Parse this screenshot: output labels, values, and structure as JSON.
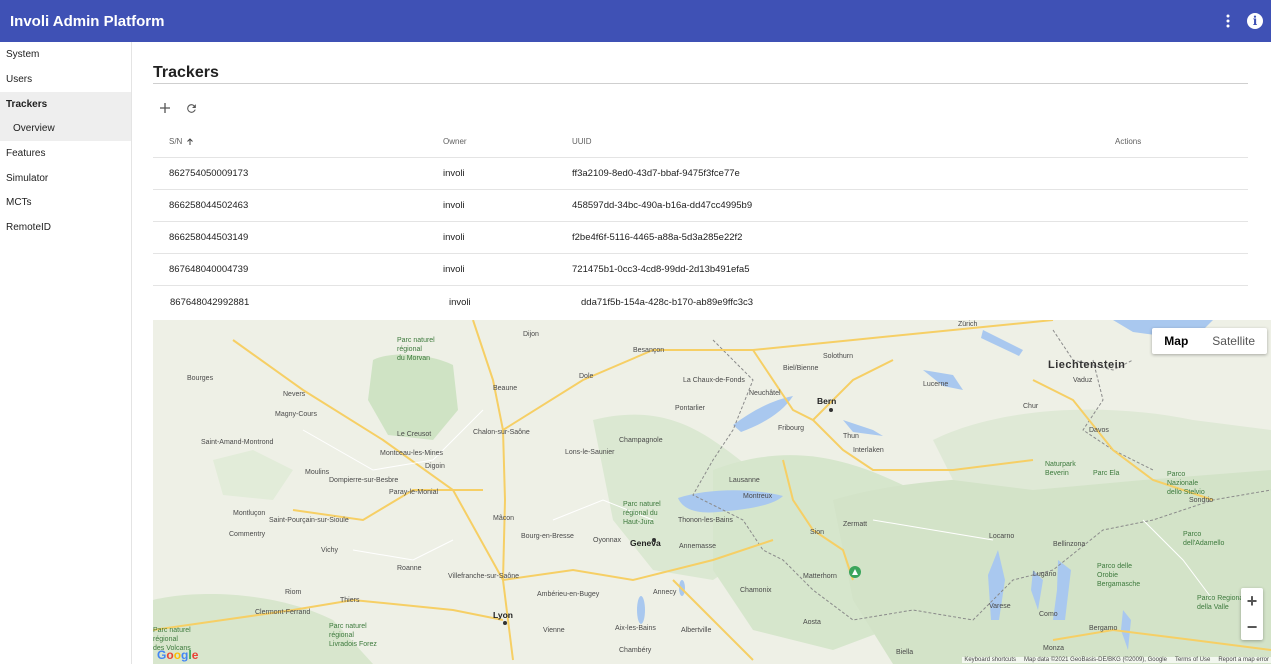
{
  "app": {
    "title": "Involi Admin Platform"
  },
  "sidebar": {
    "items": [
      {
        "label": "System"
      },
      {
        "label": "Users"
      },
      {
        "label": "Trackers"
      },
      {
        "label": "Overview"
      },
      {
        "label": "Features"
      },
      {
        "label": "Simulator"
      },
      {
        "label": "MCTs"
      },
      {
        "label": "RemoteID"
      }
    ],
    "active": "Trackers"
  },
  "page": {
    "title": "Trackers"
  },
  "toolbar": {
    "add_icon": "add-icon",
    "refresh_icon": "refresh-icon"
  },
  "table": {
    "headers": {
      "sn": "S/N",
      "owner": "Owner",
      "uuid": "UUID",
      "actions": "Actions"
    },
    "sort": {
      "column": "S/N",
      "direction": "ascending"
    },
    "rows": [
      {
        "sn": "862754050009173",
        "owner": "involi",
        "uuid": "ff3a2109-8ed0-43d7-bbaf-9475f3fce77e"
      },
      {
        "sn": "866258044502463",
        "owner": "involi",
        "uuid": "458597dd-34bc-490a-b16a-dd47cc4995b9"
      },
      {
        "sn": "866258044503149",
        "owner": "involi",
        "uuid": "f2be4f6f-5116-4465-a88a-5d3a285e22f2"
      },
      {
        "sn": "867648040004739",
        "owner": "involi",
        "uuid": "721475b1-0cc3-4cd8-99dd-2d13b491efa5"
      },
      {
        "sn": "867648042992881",
        "owner": "involi",
        "uuid": "dda71f5b-154a-428c-b170-ab89e9ffc3c3"
      }
    ]
  },
  "map": {
    "toggle": {
      "map": "Map",
      "satellite": "Satellite",
      "selected": "Map"
    },
    "zoom": {
      "in": "+",
      "out": "−"
    },
    "logo": "Google",
    "attribution": {
      "shortcuts": "Keyboard shortcuts",
      "data": "Map data ©2021 GeoBasis-DE/BKG (©2009), Google",
      "terms": "Terms of Use",
      "report": "Report a map error"
    },
    "labels": {
      "countries": [
        "Liechtenstein"
      ],
      "cities_major": [
        "Bern",
        "Geneva",
        "Lyon"
      ],
      "cities": [
        "Zürich",
        "Dijon",
        "Besançon",
        "Bourges",
        "Nevers",
        "Beaune",
        "Dole",
        "Solothurn",
        "Biel/Bienne",
        "Luzern",
        "Vaduz",
        "La Chaux-de-Fonds",
        "Neuchâtel",
        "Pontarlier",
        "Fribourg",
        "Thun",
        "Le Creusot",
        "Chalon-sur-Saône",
        "Champagnole",
        "Montceau-les-Mines",
        "Lons-le-Saunier",
        "Moulins",
        "Lausanne",
        "Montreux",
        "Montluçon",
        "Mâcon",
        "Thonon-les-Bains",
        "Sion",
        "Vichy",
        "Bourg-en-Bresse",
        "Oyonnax",
        "Annemasse",
        "Roanne",
        "Villefranche-sur-Saône",
        "Annecy",
        "Chamonix",
        "Clermont-Ferrand",
        "Thiers",
        "Chambéry",
        "Albertville",
        "Aosta",
        "Biella",
        "Varese",
        "Como",
        "Bergamo",
        "Monza",
        "Lugano",
        "Davos",
        "Chur",
        "Interlaken",
        "Matterhorn",
        "Zermatt",
        "Vienne",
        "Aix-les-Bains",
        "Riom",
        "Digoin",
        "Paray-le-Monial",
        "Commentry",
        "Saint-Pourçain-sur-Sioule",
        "Saint-Amand-Montrond",
        "Magny-Cours",
        "Dompierre-sur-Besbre",
        "Ambérieu-en-Bugey",
        "Sondrio",
        "Bellinzona",
        "Locarno"
      ],
      "parks": [
        "Parc naturel régional du Morvan",
        "Parc naturel régional du Haut-Jura",
        "Parc naturel régional Livradois Forez",
        "Parc naturel régional des Volcans",
        "Naturpark Beverin",
        "Parc Ela",
        "Parco Nazionale dello Stelvio",
        "Parco dell'Adamello",
        "Parco delle Orobie Bergamasche",
        "Parco Regionale della Valle"
      ]
    }
  }
}
